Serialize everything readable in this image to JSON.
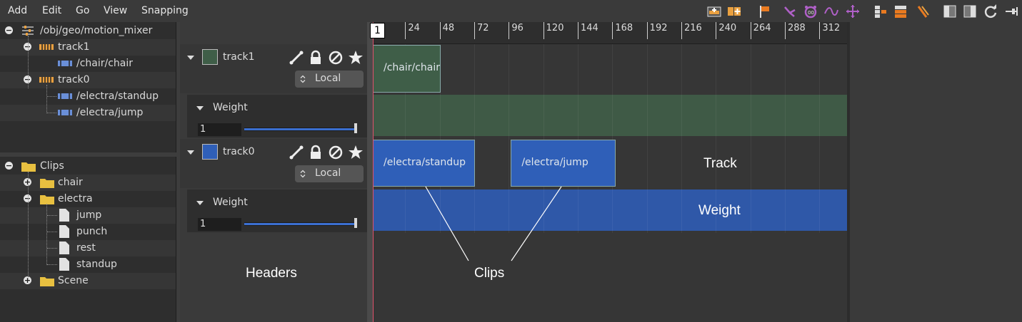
{
  "menu": {
    "items": [
      "Add",
      "Edit",
      "Go",
      "View",
      "Snapping"
    ]
  },
  "toolbar": {
    "icons": [
      "add-track-icon",
      "add-clip-icon",
      "flag-marker-icon",
      "bone-select-icon",
      "alarm-icon",
      "curve-icon",
      "move-icon",
      "layout-icon-1",
      "layout-icon-2",
      "brush-icon",
      "panel-left-icon",
      "panel-right-icon",
      "refresh-icon",
      "pin-icon"
    ]
  },
  "tree": {
    "root": "/obj/geo/motion_mixer",
    "track1": "track1",
    "track1_clip": "/chair/chair",
    "track0": "track0",
    "track0_clip_a": "/electra/standup",
    "track0_clip_b": "/electra/jump"
  },
  "clips_tree": {
    "root": "Clips",
    "chair": "chair",
    "electra": "electra",
    "electra_items": [
      "jump",
      "punch",
      "rest",
      "standup"
    ],
    "scene": "Scene"
  },
  "ruler": {
    "current_frame": "1",
    "ticks": [
      "24",
      "48",
      "72",
      "96",
      "120",
      "144",
      "168",
      "192",
      "216",
      "240",
      "264",
      "288",
      "312"
    ]
  },
  "tracks": [
    {
      "name": "track1",
      "color": "#3f5e48",
      "space": "Local",
      "weight_label": "Weight",
      "weight_value": "1"
    },
    {
      "name": "track0",
      "color": "#2f5fb8",
      "space": "Local",
      "weight_label": "Weight",
      "weight_value": "1"
    }
  ],
  "clips": {
    "track1": [
      {
        "label": "/chair/chair",
        "start": 1,
        "end": 48
      }
    ],
    "track0": [
      {
        "label": "/electra/standup",
        "start": 1,
        "end": 72
      },
      {
        "label": "/electra/jump",
        "start": 97,
        "end": 170
      }
    ]
  },
  "colors": {
    "track1_clip": "#3f5e48",
    "track1_weight": "#3f5a46",
    "track0_clip": "#2f5fb8",
    "track0_weight": "#2f58a8",
    "playhead": "#e0506a"
  },
  "annotations": {
    "headers": "Headers",
    "clips": "Clips",
    "track": "Track",
    "weight": "Weight"
  }
}
